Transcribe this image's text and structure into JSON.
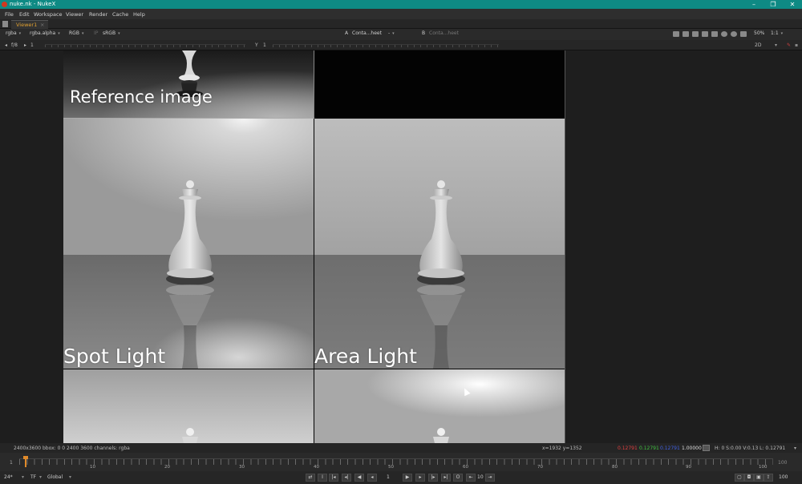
{
  "window": {
    "title": "nuke.nk - NukeX",
    "minimize": "–",
    "maximize": "❐",
    "close": "✕"
  },
  "menu": [
    "File",
    "Edit",
    "Workspace",
    "Viewer",
    "Render",
    "Cache",
    "Help"
  ],
  "tab": {
    "label": "Viewer1",
    "close": "×"
  },
  "toolbar": {
    "channels": "rgba",
    "alpha": "rgba.alpha",
    "display": "RGB",
    "lut": "sRGB",
    "input_a_label": "A",
    "input_a": "Conta...heet",
    "wipe": "-",
    "input_b_label": "B",
    "input_b": "Conta...heet",
    "zoom": "50%",
    "proxy": "1:1",
    "fstop": "f/8",
    "frame_field": "1",
    "y_label": "Y",
    "y_value": "1",
    "view_mode": "2D"
  },
  "tiles": [
    {
      "label": "Reference image"
    },
    {
      "label": "Spot Light"
    },
    {
      "label": "Area Light"
    }
  ],
  "status": {
    "format": "2400x3600",
    "bbox": "bbox: 0 0 2400 3600 channels: rgba",
    "coords": "x=1932 y=1352",
    "r": "0.12791",
    "g": "0.12791",
    "b": "0.12791",
    "a": "1.00000",
    "hsvl": "H:  0 S:0.00 V:0.13  L: 0.12791",
    "colors": {
      "r": "#e04040",
      "g": "#40c040",
      "b": "#4060e0"
    }
  },
  "timeline": {
    "start": "1",
    "end": "100",
    "ticks": [
      "10",
      "20",
      "30",
      "40",
      "50",
      "60",
      "70",
      "80",
      "90",
      "100"
    ],
    "current_frame": "1"
  },
  "transport": {
    "fps": "24*",
    "tf": "TF",
    "range": "Global",
    "frame": "1",
    "step": "10",
    "end_frame": "100"
  }
}
